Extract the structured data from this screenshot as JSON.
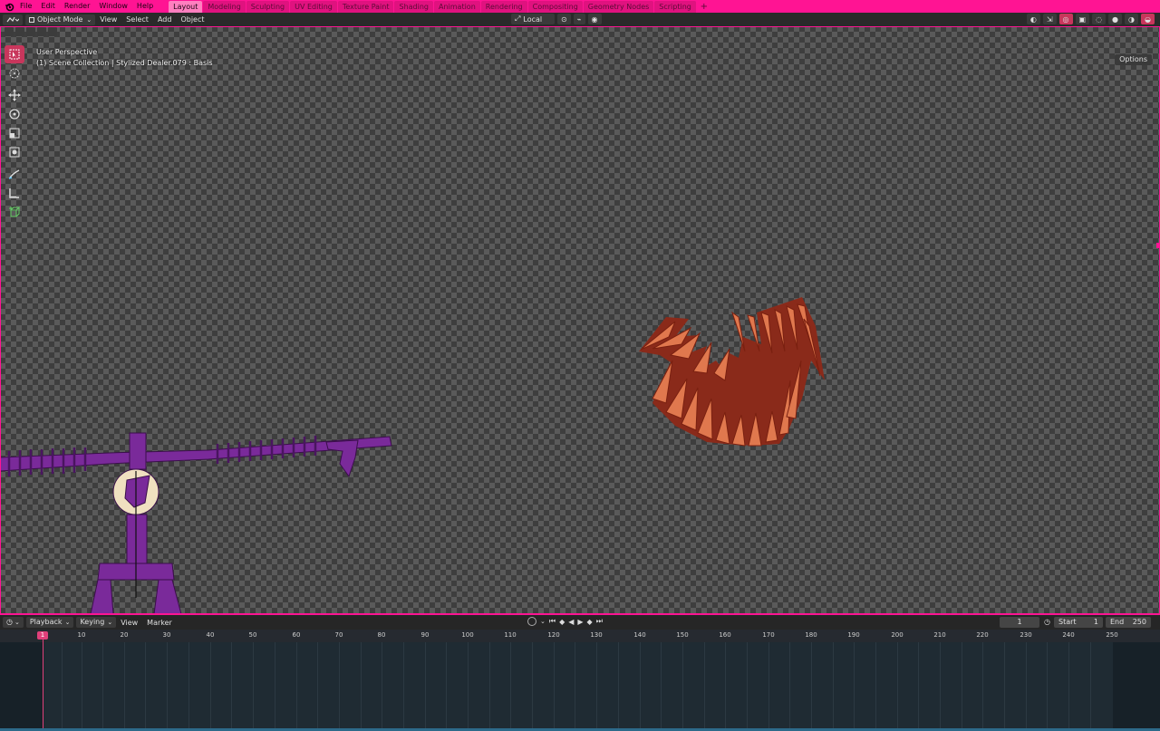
{
  "topbar": {
    "menus": [
      "File",
      "Edit",
      "Render",
      "Window",
      "Help"
    ],
    "workspaces": [
      "Layout",
      "Modeling",
      "Sculpting",
      "UV Editing",
      "Texture Paint",
      "Shading",
      "Animation",
      "Rendering",
      "Compositing",
      "Geometry Nodes",
      "Scripting"
    ],
    "active_workspace": "Layout",
    "add_label": "+"
  },
  "viewport_header": {
    "mode": "Object Mode",
    "menus": [
      "View",
      "Select",
      "Add",
      "Object"
    ],
    "transform_orientation": "Local"
  },
  "viewport": {
    "perspective": "User Perspective",
    "context": "(1) Scene Collection | Stylized Dealer.079 : Basis",
    "options_label": "Options"
  },
  "timeline": {
    "menus": [
      "Playback",
      "Keying",
      "View",
      "Marker"
    ],
    "current_frame": "1",
    "start_label": "Start",
    "start_value": "1",
    "end_label": "End",
    "end_value": "250",
    "cursor_label": "1",
    "ticks": [
      "10",
      "20",
      "30",
      "40",
      "50",
      "60",
      "70",
      "80",
      "90",
      "100",
      "110",
      "120",
      "130",
      "140",
      "150",
      "160",
      "170",
      "180",
      "190",
      "200",
      "210",
      "220",
      "230",
      "240",
      "250"
    ]
  },
  "colors": {
    "accent": "#ff1493",
    "teeth": "#e07048",
    "armature": "#7a2a9a"
  }
}
